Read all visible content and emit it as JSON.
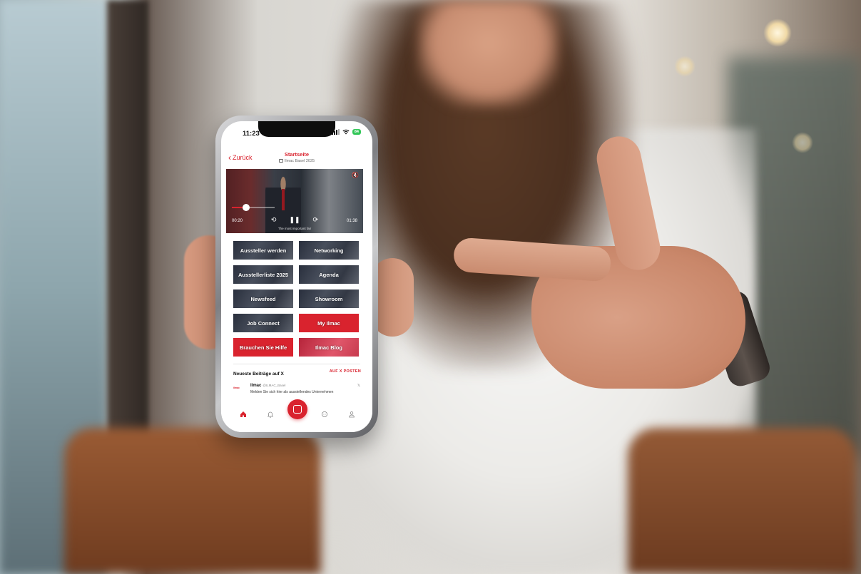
{
  "status_bar": {
    "time": "11:23",
    "battery": "84"
  },
  "nav": {
    "back_label": "Zurück",
    "title": "Startseite",
    "subtitle": "Ilmac Basel 2025"
  },
  "video": {
    "current_time": "00:20",
    "total_time": "01:38",
    "progress": 0.33,
    "caption": "The most important fair"
  },
  "tiles": [
    {
      "label": "Aussteller werden",
      "style": "photo"
    },
    {
      "label": "Networking",
      "style": "photo"
    },
    {
      "label": "Ausstellerliste 2025",
      "style": "photo"
    },
    {
      "label": "Agenda",
      "style": "photo"
    },
    {
      "label": "Newsfeed",
      "style": "photo"
    },
    {
      "label": "Showroom",
      "style": "photo"
    },
    {
      "label": "Job Connect",
      "style": "photo"
    },
    {
      "label": "My Ilmac",
      "style": "red"
    },
    {
      "label": "Brauchen Sie Hilfe",
      "style": "red"
    },
    {
      "label": "Ilmac Blog",
      "style": "redphoto"
    }
  ],
  "feed": {
    "title": "Neueste Beiträge auf X",
    "link_label": "AUF X POSTEN",
    "post": {
      "avatar_text": "ilmac",
      "author": "Ilmac",
      "handle": "@ILMAC_Basel",
      "text": "Melden Sie sich hier als ausstellendes Unternehmen"
    }
  },
  "tab_bar": {
    "items": [
      "home-icon",
      "bell-icon",
      "scan-icon",
      "chat-icon",
      "user-icon"
    ]
  },
  "colors": {
    "accent": "#d9232e",
    "battery": "#34c759"
  }
}
